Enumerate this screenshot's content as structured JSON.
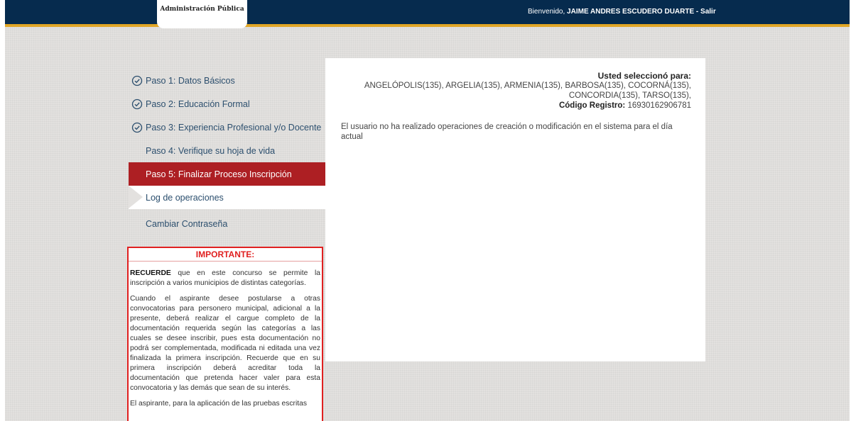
{
  "header": {
    "logo_text": "Administración Pública",
    "welcome_prefix": "Bienvenido, ",
    "user_name": "JAIME ANDRES ESCUDERO DUARTE",
    "logout_label": "- Salir"
  },
  "sidebar": {
    "items": [
      {
        "label": "Paso 1: Datos Básicos",
        "icon": "check-circle-icon",
        "state": "completed"
      },
      {
        "label": "Paso 2: Educación Formal",
        "icon": "check-circle-icon",
        "state": "completed"
      },
      {
        "label": "Paso 3: Experiencia Profesional y/o Docente",
        "icon": "check-circle-icon",
        "state": "completed"
      },
      {
        "label": "Paso 4: Verifique su hoja de vida",
        "state": "pending"
      },
      {
        "label": "Paso 5: Finalizar Proceso Inscripción",
        "state": "active"
      },
      {
        "label": "Log de operaciones",
        "state": "current"
      },
      {
        "label": "Cambiar Contraseña",
        "state": "pending"
      }
    ]
  },
  "important": {
    "title": "IMPORTANTE:",
    "p1_bold": "RECUERDE",
    "p1_text": " que en este concurso se permite la inscripción a varios municipios de distintas categorías.",
    "p2": "Cuando el aspirante desee postularse a otras convocatorias para personero municipal, adicional a la presente, deberá realizar el cargue completo de la documentación requerida según las categorías a las cuales se desee inscribir, pues esta documentación no podrá ser complementada, modificada ni editada una vez finalizada la primera inscripción. Recuerde que en su primera inscripción deberá acreditar toda la documentación que pretenda hacer valer para esta convocatoria y las demás que sean de su interés.",
    "p3": "El aspirante, para la aplicación de las pruebas escritas"
  },
  "main": {
    "selection_title": "Usted seleccionó para:",
    "selection_line1": "ANGELÓPOLIS(135), ARGELIA(135), ARMENIA(135), BARBOSA(135), COCORNÁ(135),",
    "selection_line2": "CONCORDIA(135), TARSO(135),",
    "code_label": "Código Registro:",
    "code_value": " 16930162906781",
    "log_message": "El usuario no ha realizado operaciones de creación o modificación en el sistema para el día actual"
  },
  "colors": {
    "header_bg": "#062b4e",
    "header_accent": "#e1a626",
    "active_menu": "#ad1f23",
    "important_border": "#e02020",
    "menu_text": "#2c4f6e"
  }
}
